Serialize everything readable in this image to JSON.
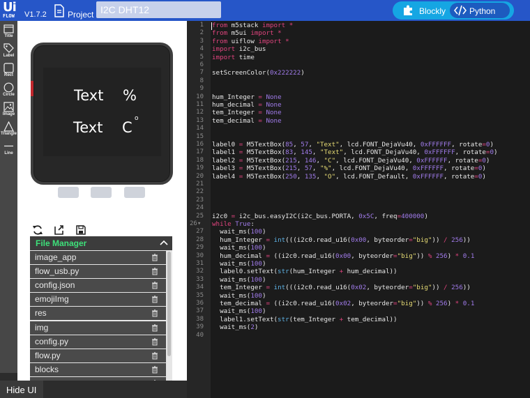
{
  "app": {
    "logo_top": "Ui",
    "logo_bottom": "FLOW",
    "version": "V1.7.2",
    "project_label": "Project",
    "project_name": "I2C DHT12"
  },
  "mode_toggle": {
    "blockly_label": "Blockly",
    "python_label": "Python",
    "active": "Python"
  },
  "tools": [
    {
      "label": "Title",
      "icon": "title-icon"
    },
    {
      "label": "Label",
      "icon": "label-tag-icon"
    },
    {
      "label": "Rect",
      "icon": "rect-icon"
    },
    {
      "label": "Circle",
      "icon": "circle-icon"
    },
    {
      "label": "Image",
      "icon": "image-icon"
    },
    {
      "label": "Triangle",
      "icon": "triangle-icon"
    },
    {
      "label": "Line",
      "icon": "line-icon"
    }
  ],
  "device_screen": {
    "text1": "Text",
    "text2": "%",
    "text3": "Text",
    "text4": "C",
    "text5": "o"
  },
  "file_manager": {
    "title": "File Manager",
    "files": [
      "image_app",
      "flow_usb.py",
      "config.json",
      "emojiImg",
      "res",
      "img",
      "config.py",
      "flow.py",
      "blocks",
      "apps"
    ]
  },
  "hide_ui_label": "Hide UI",
  "editor": {
    "line_count": 40,
    "lines": [
      [
        [
          "kw",
          "from"
        ],
        [
          "t",
          " m5stack "
        ],
        [
          "kw",
          "import"
        ],
        [
          "t",
          " "
        ],
        [
          "op",
          "*"
        ]
      ],
      [
        [
          "kw",
          "from"
        ],
        [
          "t",
          " m5ui "
        ],
        [
          "kw",
          "import"
        ],
        [
          "t",
          " "
        ],
        [
          "op",
          "*"
        ]
      ],
      [
        [
          "kw",
          "from"
        ],
        [
          "t",
          " uiflow "
        ],
        [
          "kw",
          "import"
        ],
        [
          "t",
          " "
        ],
        [
          "op",
          "*"
        ]
      ],
      [
        [
          "kw",
          "import"
        ],
        [
          "t",
          " i2c_bus"
        ]
      ],
      [
        [
          "kw",
          "import"
        ],
        [
          "t",
          " time"
        ]
      ],
      [],
      [
        [
          "t",
          "setScreenColor("
        ],
        [
          "num",
          "0x222222"
        ],
        [
          "t",
          ")"
        ]
      ],
      [],
      [],
      [
        [
          "t",
          "hum_Integer "
        ],
        [
          "op",
          "="
        ],
        [
          "t",
          " "
        ],
        [
          "num",
          "None"
        ]
      ],
      [
        [
          "t",
          "hum_decimal "
        ],
        [
          "op",
          "="
        ],
        [
          "t",
          " "
        ],
        [
          "num",
          "None"
        ]
      ],
      [
        [
          "t",
          "tem_Integer "
        ],
        [
          "op",
          "="
        ],
        [
          "t",
          " "
        ],
        [
          "num",
          "None"
        ]
      ],
      [
        [
          "t",
          "tem_decimal "
        ],
        [
          "op",
          "="
        ],
        [
          "t",
          " "
        ],
        [
          "num",
          "None"
        ]
      ],
      [],
      [],
      [
        [
          "t",
          "label0 "
        ],
        [
          "op",
          "="
        ],
        [
          "t",
          " M5TextBox("
        ],
        [
          "num",
          "85"
        ],
        [
          "t",
          ", "
        ],
        [
          "num",
          "57"
        ],
        [
          "t",
          ", "
        ],
        [
          "str",
          "\"Text\""
        ],
        [
          "t",
          ", lcd.FONT_DejaVu40, "
        ],
        [
          "num",
          "0xFFFFFF"
        ],
        [
          "t",
          ", rotate"
        ],
        [
          "op",
          "="
        ],
        [
          "num",
          "0"
        ],
        [
          "t",
          ")"
        ]
      ],
      [
        [
          "t",
          "label1 "
        ],
        [
          "op",
          "="
        ],
        [
          "t",
          " M5TextBox("
        ],
        [
          "num",
          "83"
        ],
        [
          "t",
          ", "
        ],
        [
          "num",
          "145"
        ],
        [
          "t",
          ", "
        ],
        [
          "str",
          "\"Text\""
        ],
        [
          "t",
          ", lcd.FONT_DejaVu40, "
        ],
        [
          "num",
          "0xFFFFFF"
        ],
        [
          "t",
          ", rotate"
        ],
        [
          "op",
          "="
        ],
        [
          "num",
          "0"
        ],
        [
          "t",
          ")"
        ]
      ],
      [
        [
          "t",
          "label2 "
        ],
        [
          "op",
          "="
        ],
        [
          "t",
          " M5TextBox("
        ],
        [
          "num",
          "215"
        ],
        [
          "t",
          ", "
        ],
        [
          "num",
          "146"
        ],
        [
          "t",
          ", "
        ],
        [
          "str",
          "\"C\""
        ],
        [
          "t",
          ", lcd.FONT_DejaVu40, "
        ],
        [
          "num",
          "0xFFFFFF"
        ],
        [
          "t",
          ", rotate"
        ],
        [
          "op",
          "="
        ],
        [
          "num",
          "0"
        ],
        [
          "t",
          ")"
        ]
      ],
      [
        [
          "t",
          "label3 "
        ],
        [
          "op",
          "="
        ],
        [
          "t",
          " M5TextBox("
        ],
        [
          "num",
          "215"
        ],
        [
          "t",
          ", "
        ],
        [
          "num",
          "57"
        ],
        [
          "t",
          ", "
        ],
        [
          "str",
          "\"%\""
        ],
        [
          "t",
          ", lcd.FONT_DejaVu40, "
        ],
        [
          "num",
          "0xFFFFFF"
        ],
        [
          "t",
          ", rotate"
        ],
        [
          "op",
          "="
        ],
        [
          "num",
          "0"
        ],
        [
          "t",
          ")"
        ]
      ],
      [
        [
          "t",
          "label4 "
        ],
        [
          "op",
          "="
        ],
        [
          "t",
          " M5TextBox("
        ],
        [
          "num",
          "250"
        ],
        [
          "t",
          ", "
        ],
        [
          "num",
          "135"
        ],
        [
          "t",
          ", "
        ],
        [
          "str",
          "\"O\""
        ],
        [
          "t",
          ", lcd.FONT_Default, "
        ],
        [
          "num",
          "0xFFFFFF"
        ],
        [
          "t",
          ", rotate"
        ],
        [
          "op",
          "="
        ],
        [
          "num",
          "0"
        ],
        [
          "t",
          ")"
        ]
      ],
      [],
      [],
      [],
      [],
      [
        [
          "t",
          "i2c0 "
        ],
        [
          "op",
          "="
        ],
        [
          "t",
          " i2c_bus.easyI2C(i2c_bus.PORTA, "
        ],
        [
          "num",
          "0x5C"
        ],
        [
          "t",
          ", freq"
        ],
        [
          "op",
          "="
        ],
        [
          "num",
          "400000"
        ],
        [
          "t",
          ")"
        ]
      ],
      [
        [
          "kw",
          "while"
        ],
        [
          "t",
          " "
        ],
        [
          "num",
          "True"
        ],
        [
          "t",
          ":"
        ]
      ],
      [
        [
          "t",
          "  wait_ms("
        ],
        [
          "num",
          "100"
        ],
        [
          "t",
          ")"
        ]
      ],
      [
        [
          "t",
          "  hum_Integer "
        ],
        [
          "op",
          "="
        ],
        [
          "t",
          " "
        ],
        [
          "fn",
          "int"
        ],
        [
          "t",
          "(((i2c0.read_u16("
        ],
        [
          "num",
          "0x00"
        ],
        [
          "t",
          ", byteorder"
        ],
        [
          "op",
          "="
        ],
        [
          "str",
          "\"big\""
        ],
        [
          "t",
          ")) "
        ],
        [
          "op",
          "/"
        ],
        [
          "t",
          " "
        ],
        [
          "num",
          "256"
        ],
        [
          "t",
          "))"
        ]
      ],
      [
        [
          "t",
          "  wait_ms("
        ],
        [
          "num",
          "100"
        ],
        [
          "t",
          ")"
        ]
      ],
      [
        [
          "t",
          "  hum_decimal "
        ],
        [
          "op",
          "="
        ],
        [
          "t",
          " ((i2c0.read_u16("
        ],
        [
          "num",
          "0x00"
        ],
        [
          "t",
          ", byteorder"
        ],
        [
          "op",
          "="
        ],
        [
          "str",
          "\"big\""
        ],
        [
          "t",
          ")) "
        ],
        [
          "op",
          "%"
        ],
        [
          "t",
          " "
        ],
        [
          "num",
          "256"
        ],
        [
          "t",
          ") "
        ],
        [
          "op",
          "*"
        ],
        [
          "t",
          " "
        ],
        [
          "num",
          "0.1"
        ]
      ],
      [
        [
          "t",
          "  wait_ms("
        ],
        [
          "num",
          "100"
        ],
        [
          "t",
          ")"
        ]
      ],
      [
        [
          "t",
          "  label0.setText("
        ],
        [
          "fn",
          "str"
        ],
        [
          "t",
          "(hum_Integer "
        ],
        [
          "op",
          "+"
        ],
        [
          "t",
          " hum_decimal))"
        ]
      ],
      [
        [
          "t",
          "  wait_ms("
        ],
        [
          "num",
          "100"
        ],
        [
          "t",
          ")"
        ]
      ],
      [
        [
          "t",
          "  tem_Integer "
        ],
        [
          "op",
          "="
        ],
        [
          "t",
          " "
        ],
        [
          "fn",
          "int"
        ],
        [
          "t",
          "(((i2c0.read_u16("
        ],
        [
          "num",
          "0x02"
        ],
        [
          "t",
          ", byteorder"
        ],
        [
          "op",
          "="
        ],
        [
          "str",
          "\"big\""
        ],
        [
          "t",
          ")) "
        ],
        [
          "op",
          "/"
        ],
        [
          "t",
          " "
        ],
        [
          "num",
          "256"
        ],
        [
          "t",
          "))"
        ]
      ],
      [
        [
          "t",
          "  wait_ms("
        ],
        [
          "num",
          "100"
        ],
        [
          "t",
          ")"
        ]
      ],
      [
        [
          "t",
          "  tem_decimal "
        ],
        [
          "op",
          "="
        ],
        [
          "t",
          " ((i2c0.read_u16("
        ],
        [
          "num",
          "0x02"
        ],
        [
          "t",
          ", byteorder"
        ],
        [
          "op",
          "="
        ],
        [
          "str",
          "\"big\""
        ],
        [
          "t",
          ")) "
        ],
        [
          "op",
          "%"
        ],
        [
          "t",
          " "
        ],
        [
          "num",
          "256"
        ],
        [
          "t",
          ") "
        ],
        [
          "op",
          "*"
        ],
        [
          "t",
          " "
        ],
        [
          "num",
          "0.1"
        ]
      ],
      [
        [
          "t",
          "  wait_ms("
        ],
        [
          "num",
          "100"
        ],
        [
          "t",
          ")"
        ]
      ],
      [
        [
          "t",
          "  label1.setText("
        ],
        [
          "fn",
          "str"
        ],
        [
          "t",
          "(tem_Integer "
        ],
        [
          "op",
          "+"
        ],
        [
          "t",
          " tem_decimal))"
        ]
      ],
      [
        [
          "t",
          "  wait_ms("
        ],
        [
          "num",
          "2"
        ],
        [
          "t",
          ")"
        ]
      ],
      []
    ]
  },
  "colors": {
    "topbar": "#2656c8",
    "toggle": "#15a6e3",
    "toggle_active": "#1d5bbf",
    "keyword": "#e0447e",
    "number": "#a07bea",
    "string": "#e6db74",
    "builtin": "#5fb3e6",
    "file_manager_title": "#3ee07a"
  }
}
